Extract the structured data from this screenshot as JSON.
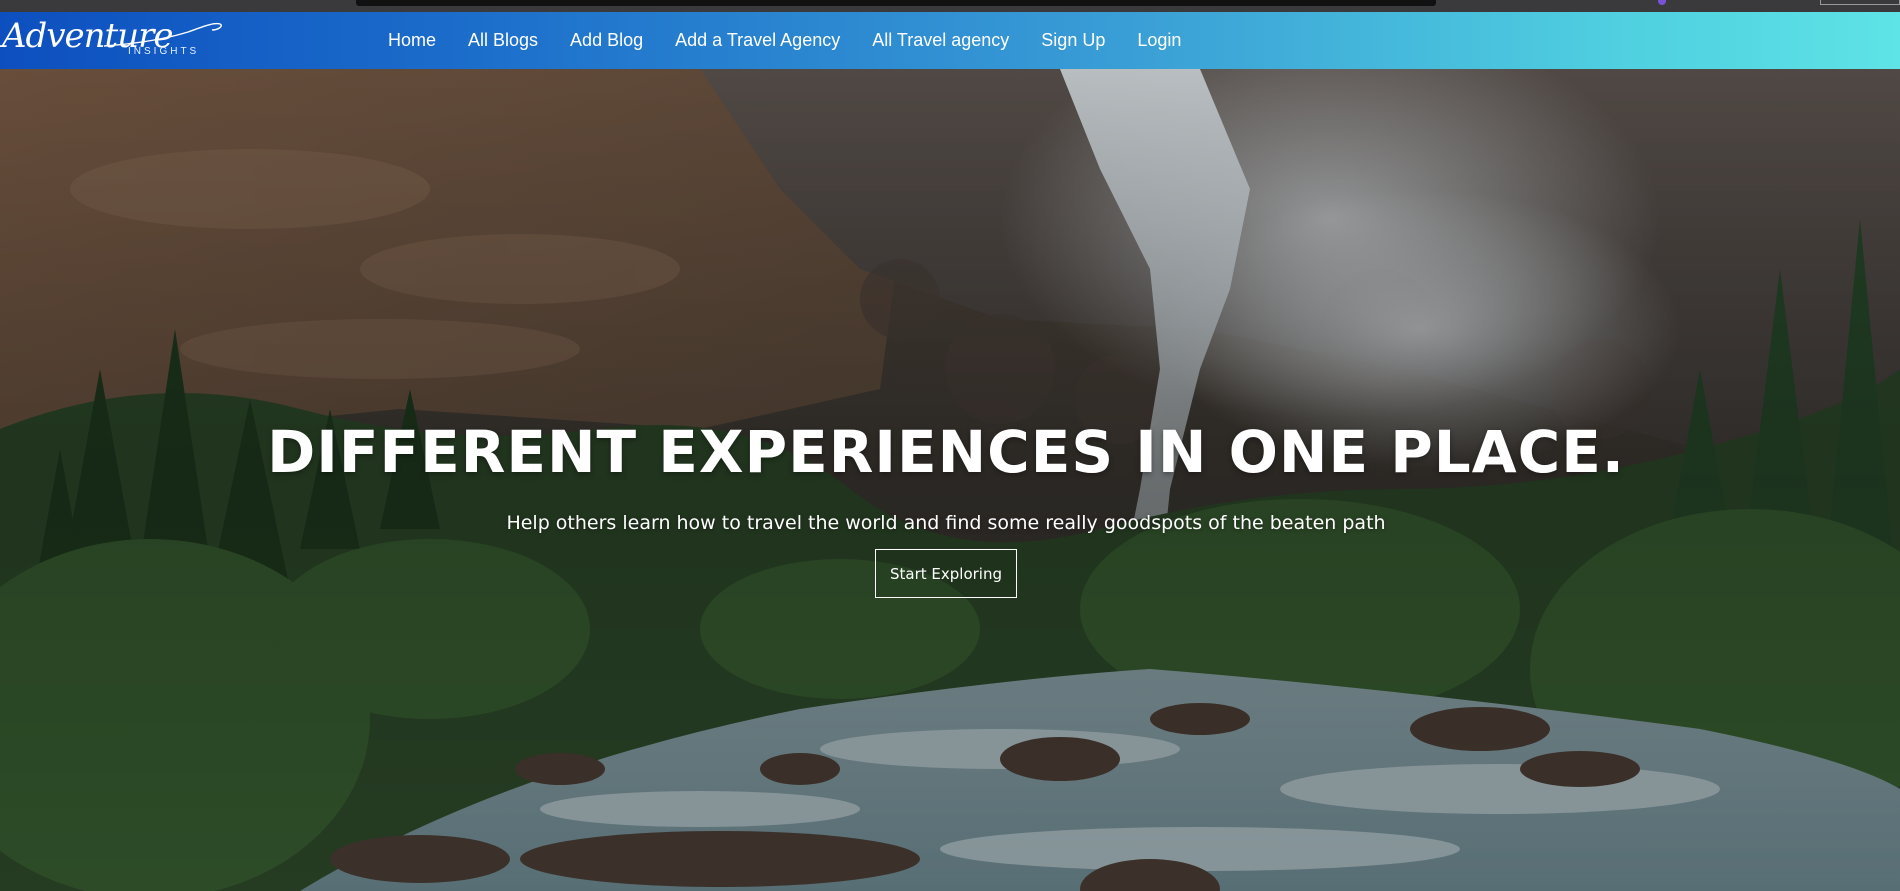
{
  "brand": {
    "logo_script": "Adventure",
    "logo_sub": "INSIGHTS"
  },
  "nav": {
    "items": [
      {
        "label": "Home"
      },
      {
        "label": "All Blogs"
      },
      {
        "label": "Add Blog"
      },
      {
        "label": "Add a Travel Agency"
      },
      {
        "label": "All Travel agency"
      },
      {
        "label": "Sign Up"
      },
      {
        "label": "Login"
      }
    ]
  },
  "hero": {
    "title": "DIFFERENT EXPERIENCES IN ONE PLACE.",
    "subtitle": "Help others learn how to travel the world and find some really goodspots of the beaten path",
    "cta_label": "Start Exploring",
    "background_description_icon": "waterfall-landscape-image"
  },
  "colors": {
    "nav_gradient_start": "#0d4fbf",
    "nav_gradient_end": "#5ee3e6",
    "text": "#ffffff"
  }
}
